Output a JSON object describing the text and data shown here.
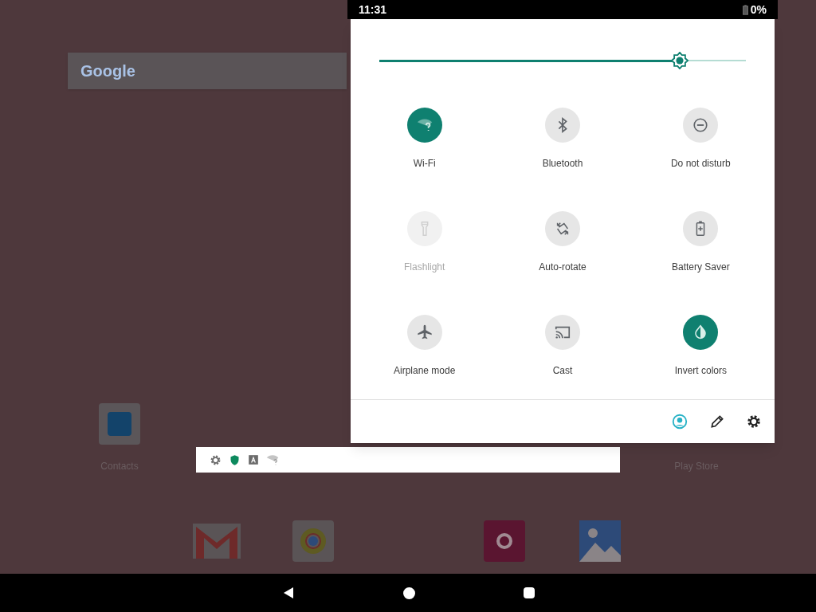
{
  "status_bar": {
    "time": "11:31",
    "battery": "0%"
  },
  "desktop": {
    "search_logo": "Google",
    "apps": [
      {
        "label": "Contacts"
      },
      {
        "label": "Play Store"
      }
    ]
  },
  "quick_settings": {
    "brightness": {
      "level": 0.82
    },
    "tiles": [
      {
        "label": "Wi-Fi",
        "on": true,
        "disabled": false
      },
      {
        "label": "Bluetooth",
        "on": false,
        "disabled": false
      },
      {
        "label": "Do not disturb",
        "on": false,
        "disabled": false
      },
      {
        "label": "Flashlight",
        "on": false,
        "disabled": true
      },
      {
        "label": "Auto-rotate",
        "on": false,
        "disabled": false
      },
      {
        "label": "Battery Saver",
        "on": false,
        "disabled": false
      },
      {
        "label": "Airplane mode",
        "on": false,
        "disabled": false
      },
      {
        "label": "Cast",
        "on": false,
        "disabled": false
      },
      {
        "label": "Invert colors",
        "on": true,
        "disabled": false
      }
    ]
  }
}
